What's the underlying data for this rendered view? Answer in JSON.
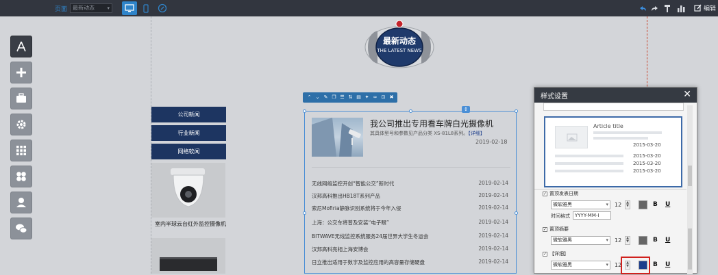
{
  "topbar": {
    "page_label": "页面",
    "page_select": "最新动态",
    "edit_label": "编辑"
  },
  "badge": {
    "title": "最新动态",
    "subtitle": "THE LATEST NEWS"
  },
  "left_menu": {
    "items": [
      "公司新闻",
      "行业新闻",
      "网络软闻"
    ],
    "product_caption": "室内半球云台红外监控摄像机"
  },
  "featured": {
    "title": "我公司推出专用看车牌白光摄像机",
    "desc": "其具体型号和参数见产品分类 XS-81L8系列。",
    "more": "【详细】",
    "date": "2019-02-18"
  },
  "news": [
    {
      "title": "无线网络监控开创“智能公交”新时代",
      "date": "2019-02-14"
    },
    {
      "title": "汉邦高科推出HB18T系列产品",
      "date": "2019-02-14"
    },
    {
      "title": "索尼Mofiria静脉识别系统将于今年入侵",
      "date": "2019-02-14"
    },
    {
      "title": "上海：公交车将普及安装“电子眼”",
      "date": "2019-02-14"
    },
    {
      "title": "BITWAVE无线监控系统服务24届世界大学生冬运会",
      "date": "2019-02-14"
    },
    {
      "title": "汉邦高科亮相上海安博会",
      "date": "2019-02-14"
    },
    {
      "title": "日立推出适用于数字及监控应用的高容量存储硬盘",
      "date": "2019-02-14"
    }
  ],
  "panel": {
    "title": "样式设置",
    "preview": {
      "article_title": "Article title",
      "dates": [
        "2015-03-20",
        "2015-03-20",
        "2015-03-20",
        "2015-03-20"
      ]
    },
    "rows": [
      {
        "label": "置顶发表日期",
        "font": "微软雅黑",
        "size": "12",
        "color": "#666666"
      },
      {
        "label": "置顶摘要",
        "font": "微软雅黑",
        "size": "12",
        "color": "#666666"
      },
      {
        "label": "【详细】",
        "font": "微软雅黑",
        "size": "12",
        "color": "#1d3e8c"
      }
    ],
    "time_format_label": "时间格式",
    "time_format_value": "YYYY-MM-I",
    "bold": "B",
    "underline": "U"
  }
}
